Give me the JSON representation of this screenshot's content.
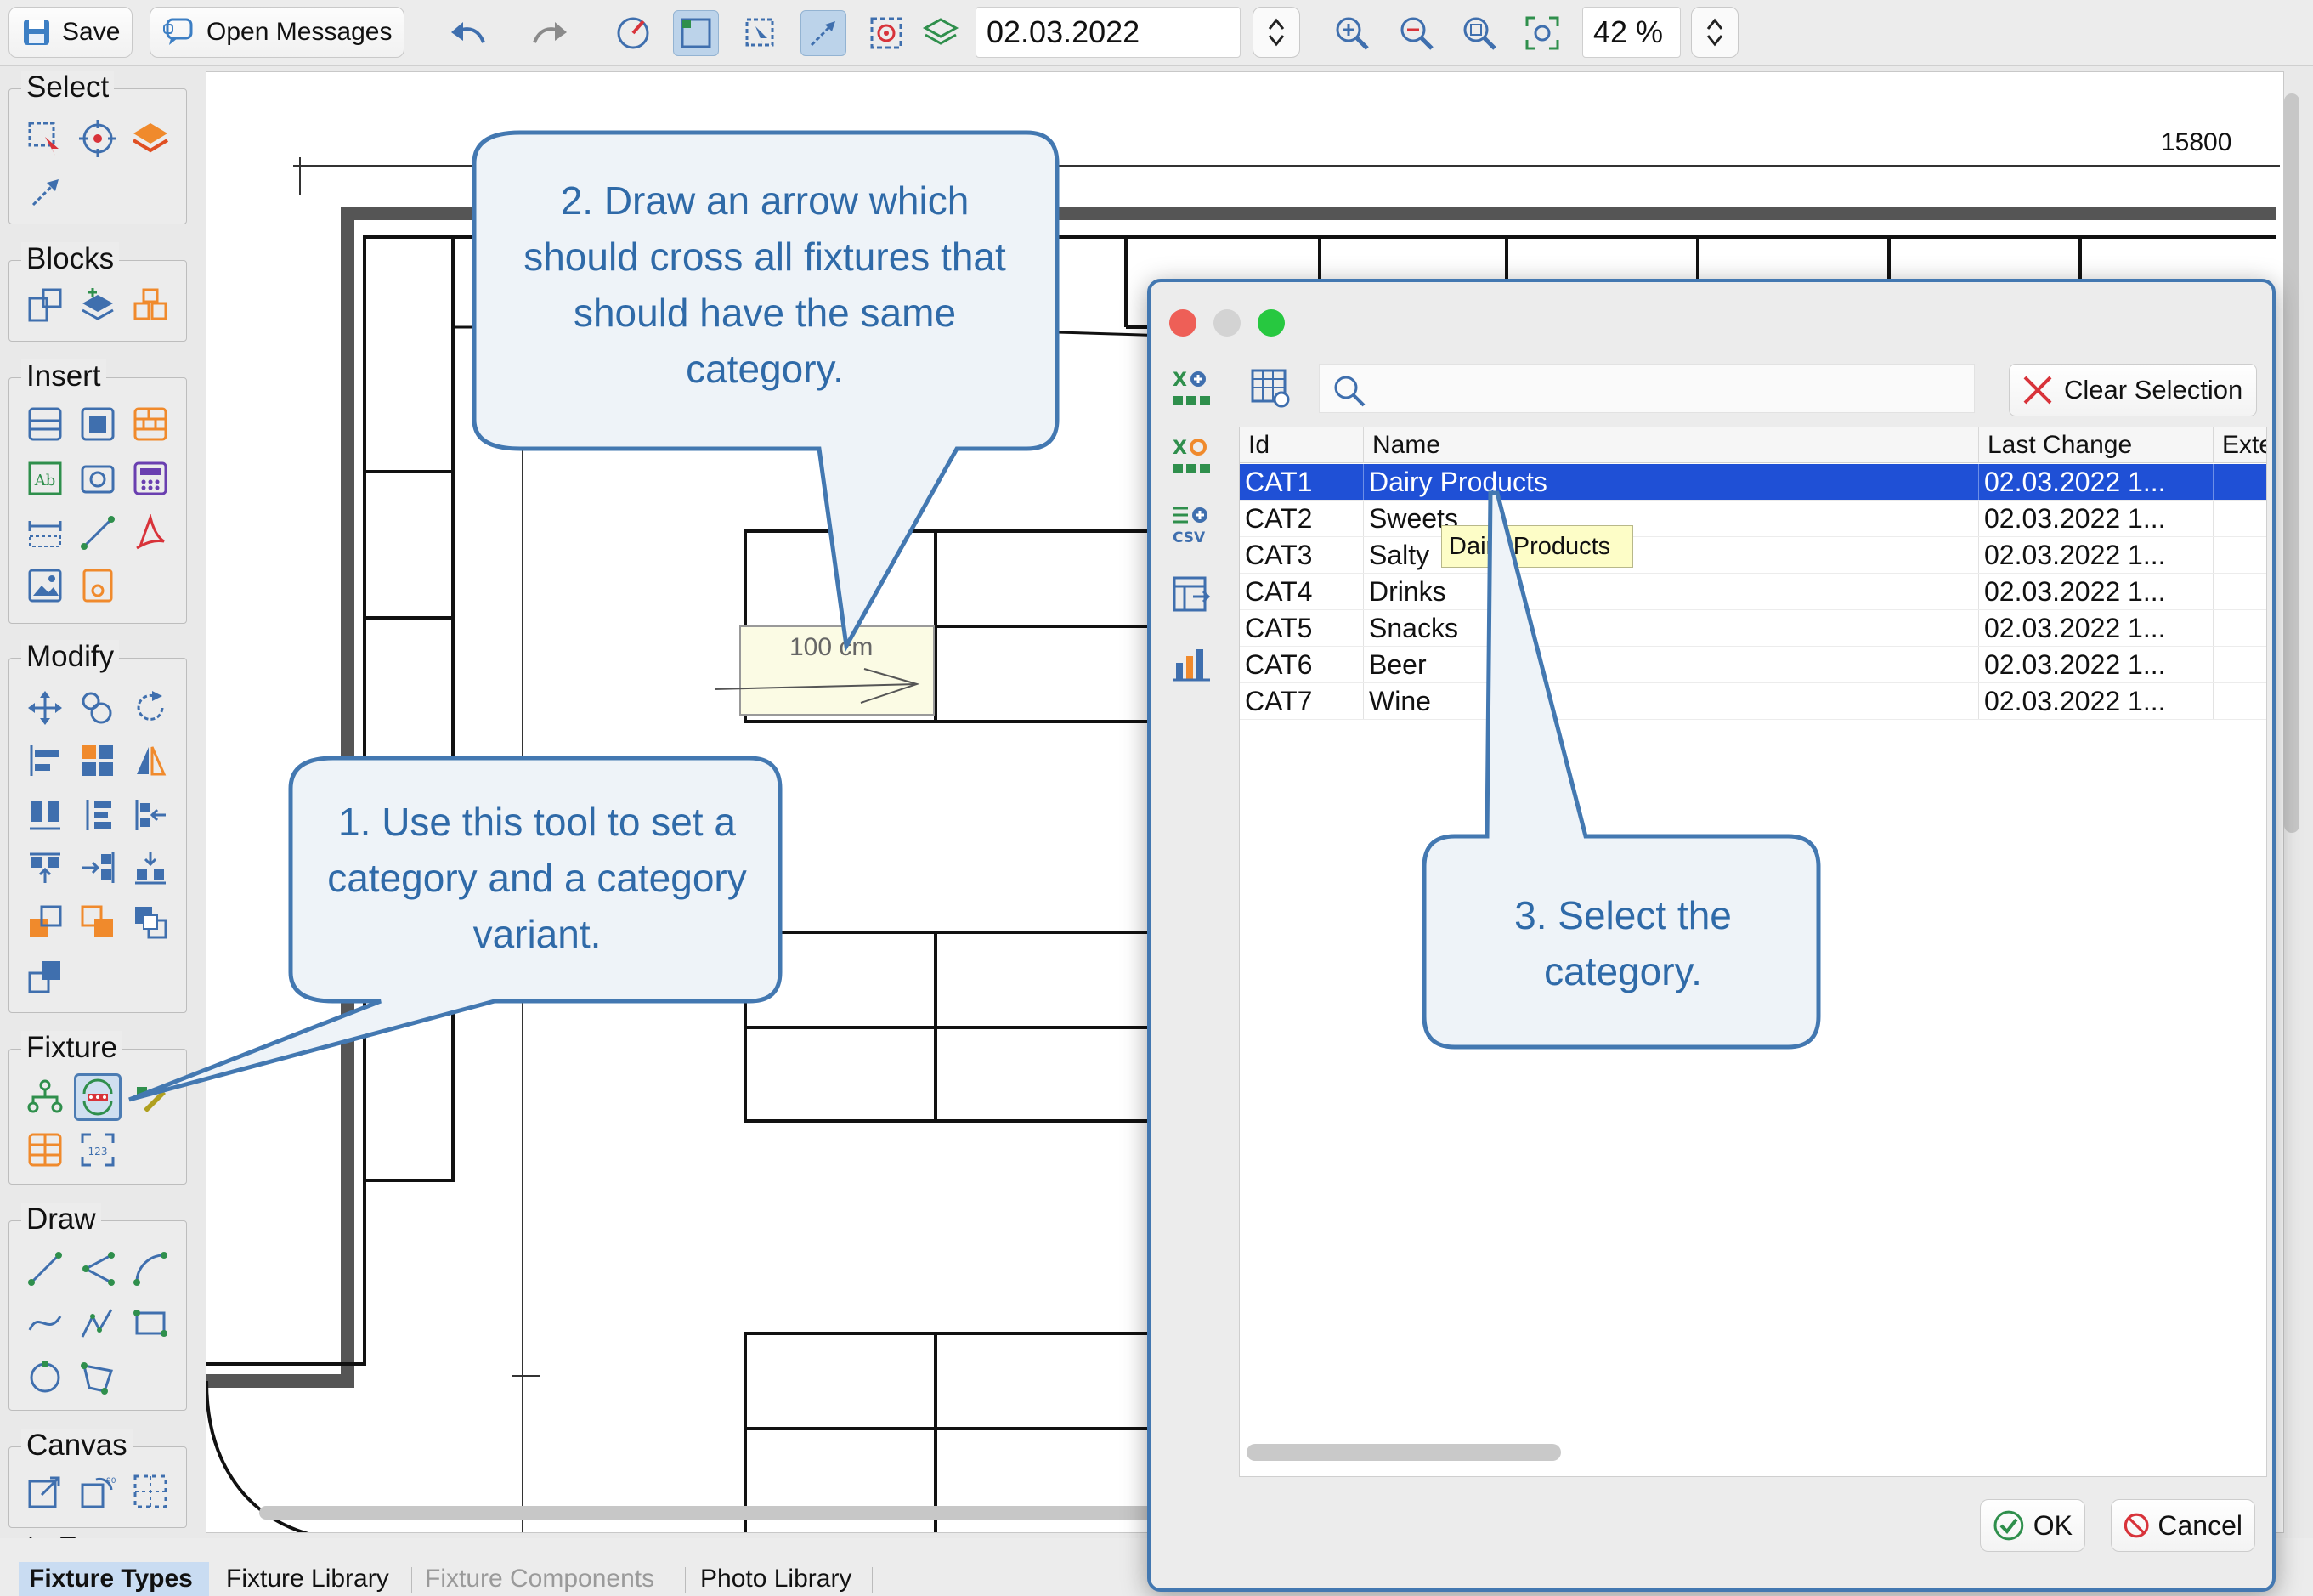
{
  "toolbar": {
    "save_label": "Save",
    "messages_label": "Open Messages",
    "date_value": "02.03.2022",
    "zoom_value": "42 %"
  },
  "palette": {
    "select_title": "Select",
    "blocks_title": "Blocks",
    "insert_title": "Insert",
    "modify_title": "Modify",
    "fixture_title": "Fixture",
    "draw_title": "Draw",
    "canvas_title": "Canvas"
  },
  "canvas": {
    "dimension_label": "15800",
    "measure_label": "100 cm"
  },
  "dialog": {
    "clear_selection_label": "Clear Selection",
    "columns": [
      "Id",
      "Name",
      "Last Change",
      "Exte"
    ],
    "rows": [
      {
        "id": "CAT1",
        "name": "Dairy Products",
        "last_change": "02.03.2022 1..."
      },
      {
        "id": "CAT2",
        "name": "Sweets",
        "last_change": "02.03.2022 1..."
      },
      {
        "id": "CAT3",
        "name": "Salty",
        "last_change": "02.03.2022 1..."
      },
      {
        "id": "CAT4",
        "name": "Drinks",
        "last_change": "02.03.2022 1..."
      },
      {
        "id": "CAT5",
        "name": "Snacks",
        "last_change": "02.03.2022 1..."
      },
      {
        "id": "CAT6",
        "name": "Beer",
        "last_change": "02.03.2022 1..."
      },
      {
        "id": "CAT7",
        "name": "Wine",
        "last_change": "02.03.2022 1..."
      }
    ],
    "csv_label": "CSV",
    "tooltip": "Dairy Products",
    "ok_label": "OK",
    "cancel_label": "Cancel"
  },
  "callouts": {
    "step1": "1. Use this tool to set a category and a category variant.",
    "step2": "2. Draw an arrow which should cross all fixtures that should have the same category.",
    "step3": "3. Select the category."
  },
  "tabs": [
    "Fixture Types",
    "Fixture Library",
    "Fixture Components",
    "Photo Library"
  ],
  "colors": {
    "accent": "#4378b1",
    "selection": "#1f50d6",
    "callout_text": "#2f6aa8",
    "callout_fill": "#eef3f8",
    "tooltip_fill": "#fdfdc7"
  }
}
